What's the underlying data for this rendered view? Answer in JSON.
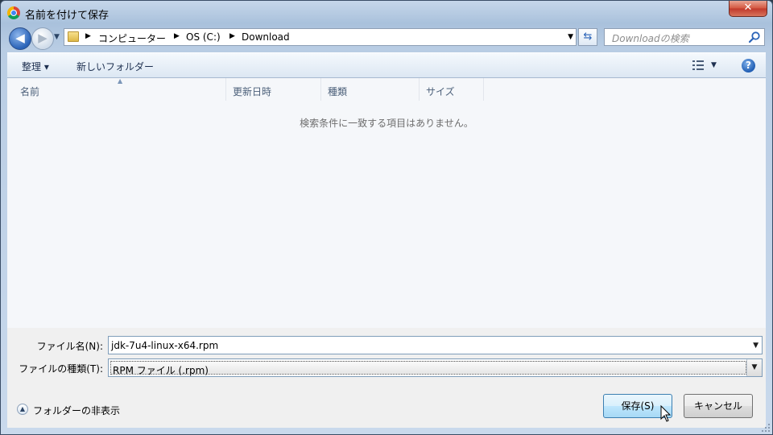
{
  "window": {
    "title": "名前を付けて保存",
    "close_label": "✕"
  },
  "nav": {
    "back_icon": "arrow-left-icon",
    "forward_icon": "arrow-right-icon",
    "recent_icon": "chevron-down-icon"
  },
  "breadcrumb": [
    "コンピューター",
    "OS (C:)",
    "Download"
  ],
  "search": {
    "placeholder": "Downloadの検索"
  },
  "toolbar": {
    "organize_label": "整理 ▾",
    "new_folder_label": "新しいフォルダー"
  },
  "columns": [
    "名前",
    "更新日時",
    "種類",
    "サイズ"
  ],
  "empty_message": "検索条件に一致する項目はありません。",
  "form": {
    "filename_label": "ファイル名(N):",
    "filename_value": "jdk-7u4-linux-x64.rpm",
    "filetype_label": "ファイルの種類(T):",
    "filetype_value": "RPM ファイル (.rpm)"
  },
  "hide_folders_label": "フォルダーの非表示",
  "buttons": {
    "save_label": "保存(S)",
    "cancel_label": "キャンセル"
  },
  "colors": {
    "accent": "#2a63b8",
    "frame": "#b9cde4",
    "close": "#c0392b"
  }
}
